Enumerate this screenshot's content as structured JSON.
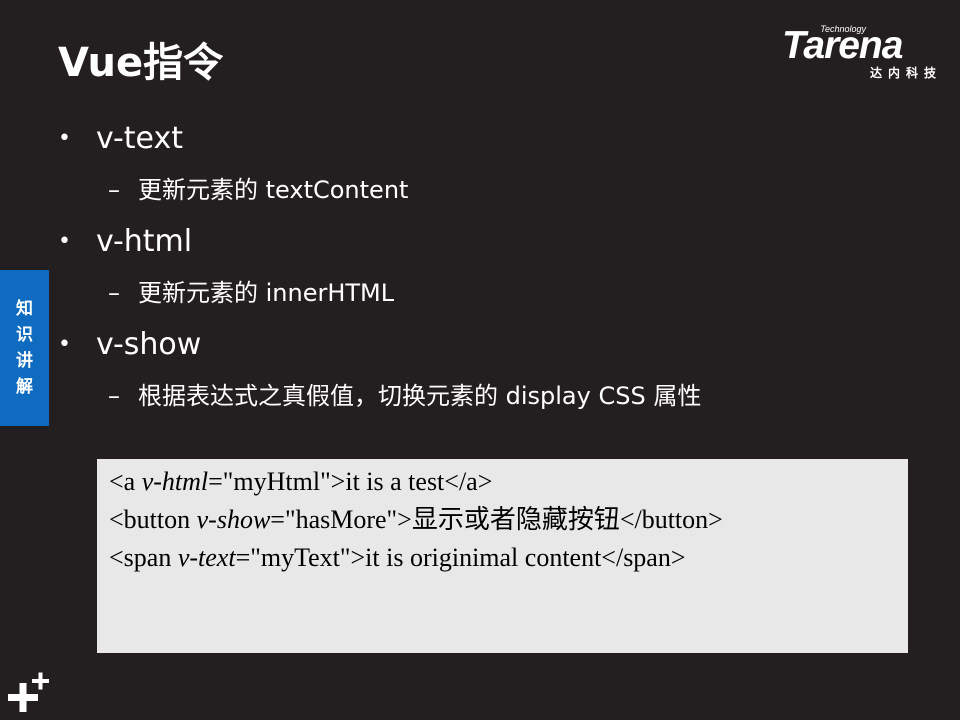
{
  "title": "Vue指令",
  "logo": {
    "word": "Tarena",
    "technology": "Technology",
    "chinese": "达内科技"
  },
  "side_tab": "知识讲解",
  "bullets": [
    {
      "marker": "•",
      "text": "v-text",
      "sub": {
        "marker": "–",
        "text": "更新元素的 textContent"
      }
    },
    {
      "marker": "•",
      "text": "v-html",
      "sub": {
        "marker": "–",
        "text": "更新元素的 innerHTML"
      }
    },
    {
      "marker": "•",
      "text": "v-show",
      "sub": {
        "marker": "–",
        "text": "根据表达式之真假值，切换元素的  display CSS 属性"
      }
    }
  ],
  "code": [
    {
      "pre": "<a ",
      "attr": "v-html",
      "post": "=\"myHtml\">it  is a test</a>"
    },
    {
      "pre": "<button ",
      "attr": "v-show",
      "post": "=\"hasMore\">显示或者隐藏按钮</button>"
    },
    {
      "pre": "<span ",
      "attr": "v-text",
      "post": "=\"myText\">it  is originimal content</span>"
    }
  ]
}
